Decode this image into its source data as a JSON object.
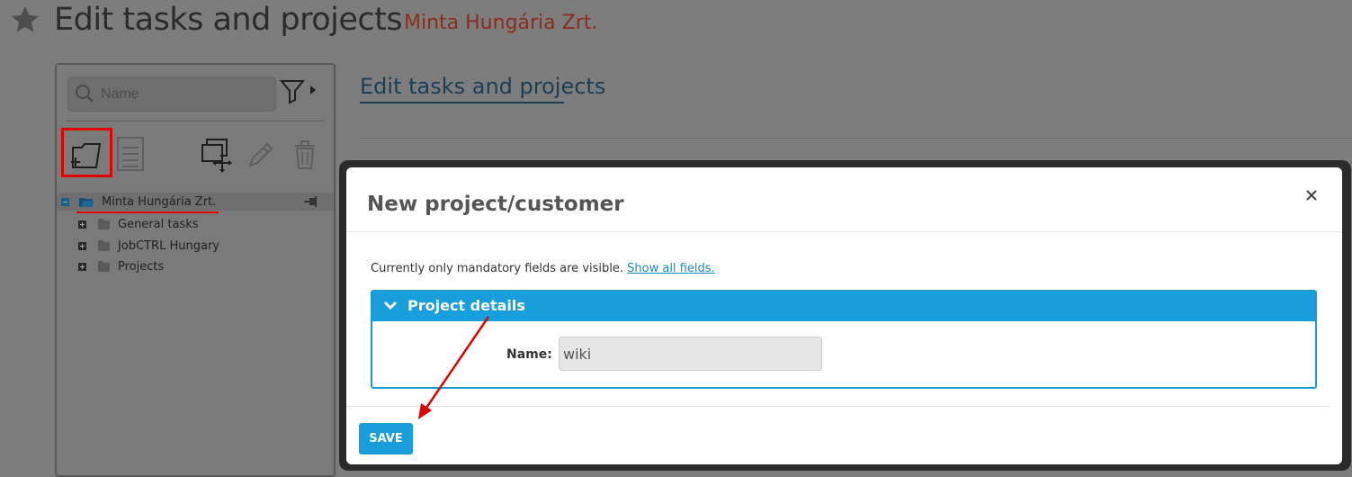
{
  "header": {
    "title": "Edit tasks and projects",
    "company": "Minta Hungária Zrt."
  },
  "sidebar": {
    "search_placeholder": "Name",
    "tree": {
      "root": "Minta Hungária Zrt.",
      "children": [
        "General tasks",
        "JobCTRL Hungary",
        "Projects"
      ]
    }
  },
  "main": {
    "tab_label": "Edit tasks and projects"
  },
  "modal": {
    "title": "New project/customer",
    "info_text": "Currently only mandatory fields are visible.",
    "show_all_link": "Show all fields.",
    "section_title": "Project details",
    "name_label": "Name:",
    "name_value": "wiki",
    "save_label": "SAVE"
  },
  "colors": {
    "accent": "#179edb",
    "annotation": "#e00000",
    "company_text": "#8a2d1c"
  }
}
